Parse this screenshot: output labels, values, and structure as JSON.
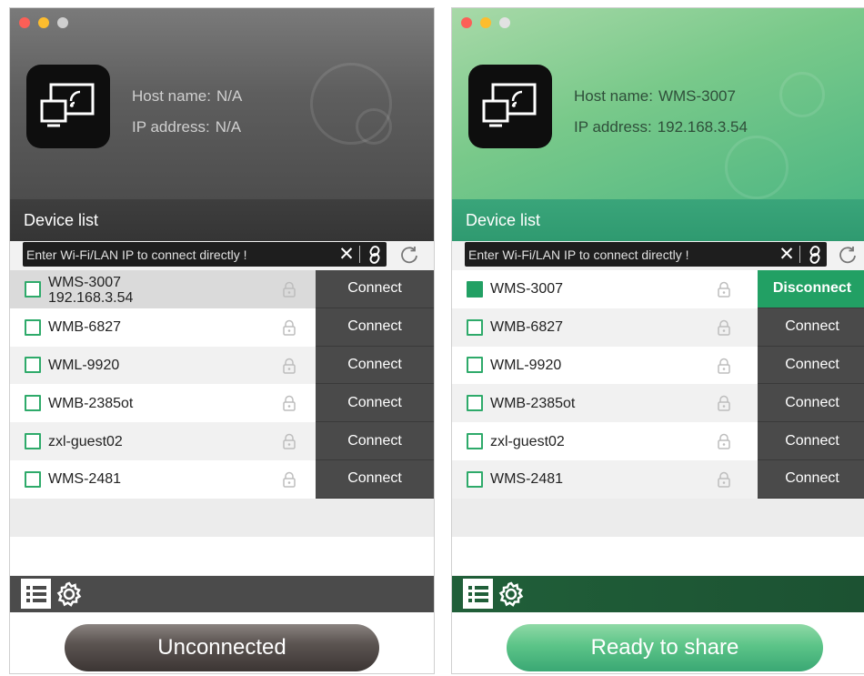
{
  "left": {
    "host_label": "Host name:",
    "host_value": "N/A",
    "ip_label": "IP address:",
    "ip_value": "N/A",
    "device_list_title": "Device list",
    "ip_placeholder": "Enter Wi-Fi/LAN IP to connect directly !",
    "devices": [
      {
        "name": "WMS-3007",
        "ip": "192.168.3.54",
        "button": "Connect",
        "checked": false
      },
      {
        "name": "WMB-6827",
        "button": "Connect",
        "checked": false
      },
      {
        "name": "WML-9920",
        "button": "Connect",
        "checked": false
      },
      {
        "name": "WMB-2385ot",
        "button": "Connect",
        "checked": false
      },
      {
        "name": "zxl-guest02",
        "button": "Connect",
        "checked": false
      },
      {
        "name": "WMS-2481",
        "button": "Connect",
        "checked": false
      }
    ],
    "status": "Unconnected"
  },
  "right": {
    "host_label": "Host name:",
    "host_value": "WMS-3007",
    "ip_label": "IP address:",
    "ip_value": "192.168.3.54",
    "device_list_title": "Device list",
    "ip_placeholder": "Enter Wi-Fi/LAN IP to connect directly !",
    "devices": [
      {
        "name": "WMS-3007",
        "button": "Disconnect",
        "checked": true
      },
      {
        "name": "WMB-6827",
        "button": "Connect",
        "checked": false
      },
      {
        "name": "WML-9920",
        "button": "Connect",
        "checked": false
      },
      {
        "name": "WMB-2385ot",
        "button": "Connect",
        "checked": false
      },
      {
        "name": "zxl-guest02",
        "button": "Connect",
        "checked": false
      },
      {
        "name": "WMS-2481",
        "button": "Connect",
        "checked": false
      }
    ],
    "status": "Ready to share"
  },
  "icons": {
    "window_controls": [
      "close-light",
      "minimize-light",
      "zoom-light"
    ],
    "app": "screen-cast-icon",
    "lock": "lock-icon",
    "clear": "close-icon",
    "link": "link-icon",
    "refresh": "refresh-icon",
    "list_tab": "list-icon",
    "settings_tab": "gear-icon"
  },
  "colors": {
    "connected_accent": "#22a064",
    "checkbox_border": "#2eaa6a",
    "button_dark": "#4a4a4a",
    "left_header": "#5e5e5e",
    "right_header": "#79c98a"
  }
}
